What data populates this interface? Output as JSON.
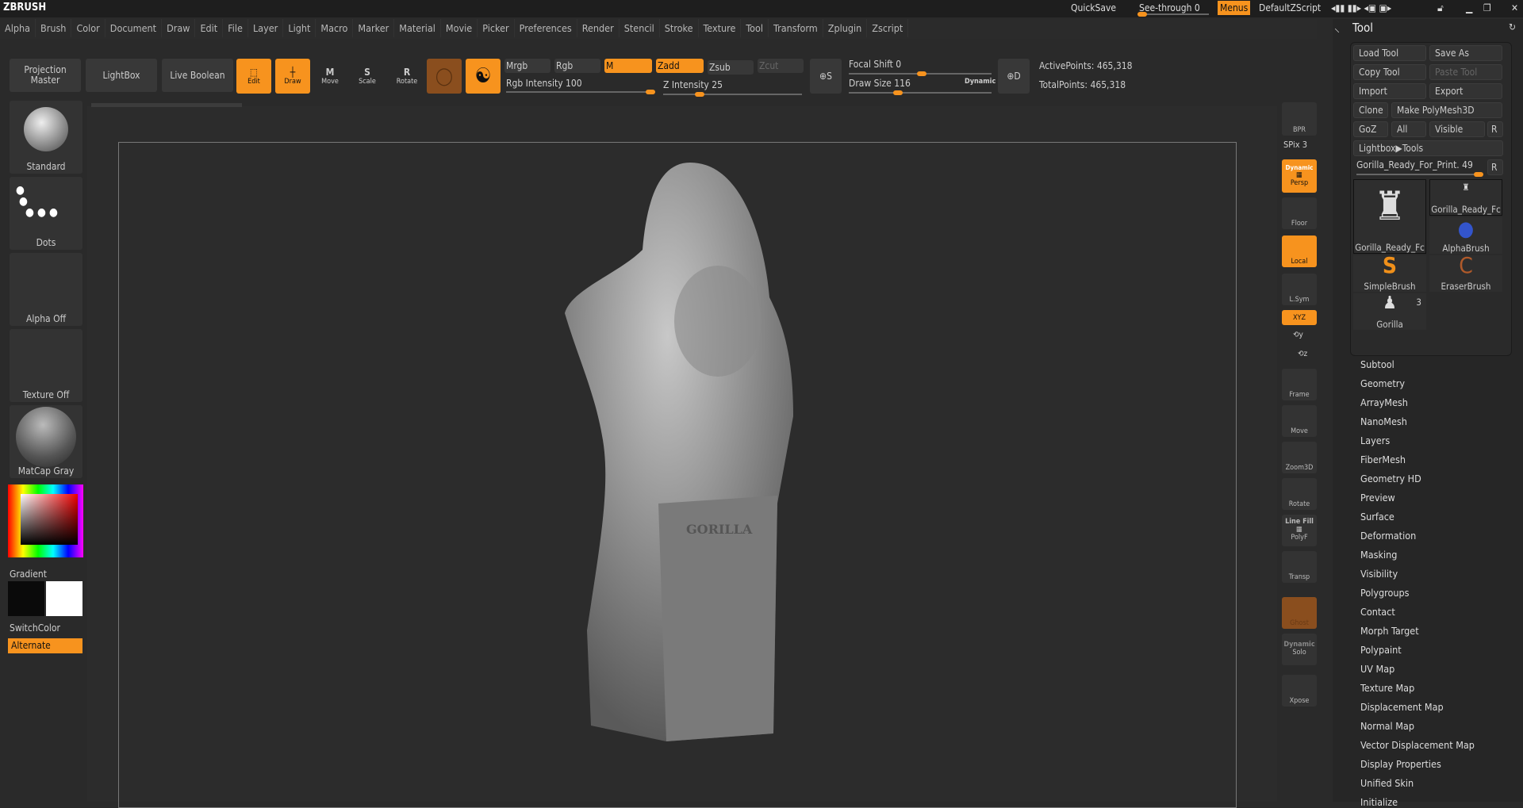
{
  "app": {
    "logo": "ZBRUSH"
  },
  "topbar": {
    "quicksave": "QuickSave",
    "see_through": "See-through  0",
    "see_through_value": 0,
    "menus": "Menus",
    "script": "DefaultZScript"
  },
  "menus": [
    "Alpha",
    "Brush",
    "Color",
    "Document",
    "Draw",
    "Edit",
    "File",
    "Layer",
    "Light",
    "Macro",
    "Marker",
    "Material",
    "Movie",
    "Picker",
    "Preferences",
    "Render",
    "Stencil",
    "Stroke",
    "Texture",
    "Tool",
    "Transform",
    "Zplugin",
    "Zscript"
  ],
  "toolbar": {
    "projection_master": "Projection Master",
    "lightbox": "LightBox",
    "live_boolean": "Live Boolean",
    "edit": "Edit",
    "draw": "Draw",
    "move": "Move",
    "scale": "Scale",
    "rotate": "Rotate",
    "mrgb": "Mrgb",
    "rgb": "Rgb",
    "m": "M",
    "zadd": "Zadd",
    "zsub": "Zsub",
    "zcut": "Zcut",
    "rgb_intensity": "Rgb Intensity 100",
    "rgb_intensity_value": 100,
    "z_intensity": "Z Intensity 25",
    "z_intensity_value": 25,
    "focal_shift": "Focal Shift 0",
    "focal_shift_value": 0,
    "draw_size": "Draw Size 116",
    "draw_size_value": 116,
    "dynamic": "Dynamic",
    "active_points": "ActivePoints: 465,318",
    "total_points": "TotalPoints: 465,318"
  },
  "left": {
    "brush": "Standard",
    "stroke": "Dots",
    "alpha": "Alpha Off",
    "texture": "Texture Off",
    "material": "MatCap Gray",
    "gradient": "Gradient",
    "switchcolor": "SwitchColor",
    "alternate": "Alternate"
  },
  "shelf": {
    "bpr": "BPR",
    "spix": "SPix 3",
    "dynamic": "Dynamic",
    "persp": "Persp",
    "floor": "Floor",
    "local": "Local",
    "lsym": "L.Sym",
    "xyz": "XYZ",
    "frame": "Frame",
    "move": "Move",
    "zoom3d": "Zoom3D",
    "rotate": "Rotate",
    "linefill": "Line Fill",
    "polyf": "PolyF",
    "transp": "Transp",
    "ghost": "Ghost",
    "dynamic2": "Dynamic",
    "solo": "Solo",
    "xpose": "Xpose"
  },
  "tool": {
    "title": "Tool",
    "load": "Load Tool",
    "save_as": "Save As",
    "copy": "Copy Tool",
    "paste": "Paste Tool",
    "import": "Import",
    "export": "Export",
    "clone": "Clone",
    "make_polymesh": "Make PolyMesh3D",
    "goz": "GoZ",
    "all": "All",
    "visible": "Visible",
    "r": "R",
    "lightbox_tools": "Lightbox▶Tools",
    "current": "Gorilla_Ready_For_Print. 49",
    "current_value": 49,
    "thumbs": [
      {
        "label": "Gorilla_Ready_Fc"
      },
      {
        "label": "Gorilla_Ready_Fc"
      },
      {
        "label": "AlphaBrush"
      },
      {
        "label": "SimpleBrush"
      },
      {
        "label": "EraserBrush"
      },
      {
        "label": "Gorilla",
        "count": "3"
      }
    ],
    "subpalettes": [
      "Subtool",
      "Geometry",
      "ArrayMesh",
      "NanoMesh",
      "Layers",
      "FiberMesh",
      "Geometry HD",
      "Preview",
      "Surface",
      "Deformation",
      "Masking",
      "Visibility",
      "Polygroups",
      "Contact",
      "Morph Target",
      "Polypaint",
      "UV Map",
      "Texture Map",
      "Displacement Map",
      "Normal Map",
      "Vector Displacement Map",
      "Display Properties",
      "Unified Skin",
      "Initialize"
    ]
  },
  "model": {
    "engraving": "GORILLA"
  },
  "colors": {
    "accent": "#f7931e"
  }
}
